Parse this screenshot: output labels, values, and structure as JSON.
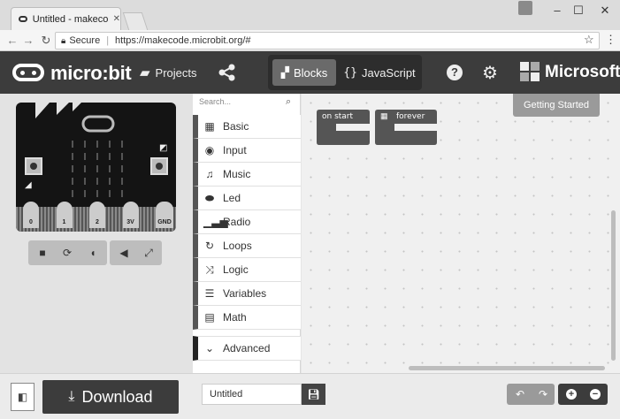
{
  "browser": {
    "tab_title": "Untitled - makecode.mic",
    "secure_label": "Secure",
    "url": "https://makecode.microbit.org/#"
  },
  "app": {
    "logo": "micro:bit",
    "projects_label": "Projects",
    "mode_blocks": "Blocks",
    "mode_javascript": "JavaScript",
    "brand": "Microsoft",
    "getting_started": "Getting Started"
  },
  "simulator": {
    "pins": [
      "0",
      "1",
      "2",
      "3V",
      "GND"
    ]
  },
  "toolbox": {
    "search_placeholder": "Search...",
    "categories": [
      {
        "label": "Basic",
        "icon": "grid-icon"
      },
      {
        "label": "Input",
        "icon": "radio-button-icon"
      },
      {
        "label": "Music",
        "icon": "headphones-icon"
      },
      {
        "label": "Led",
        "icon": "toggle-icon"
      },
      {
        "label": "Radio",
        "icon": "signal-bars-icon"
      },
      {
        "label": "Loops",
        "icon": "refresh-icon"
      },
      {
        "label": "Logic",
        "icon": "shuffle-icon"
      },
      {
        "label": "Variables",
        "icon": "list-icon"
      },
      {
        "label": "Math",
        "icon": "calculator-icon"
      }
    ],
    "advanced_label": "Advanced"
  },
  "workspace": {
    "blocks": [
      "on start",
      "forever"
    ]
  },
  "bottom": {
    "download_label": "Download",
    "project_name": "Untitled"
  }
}
